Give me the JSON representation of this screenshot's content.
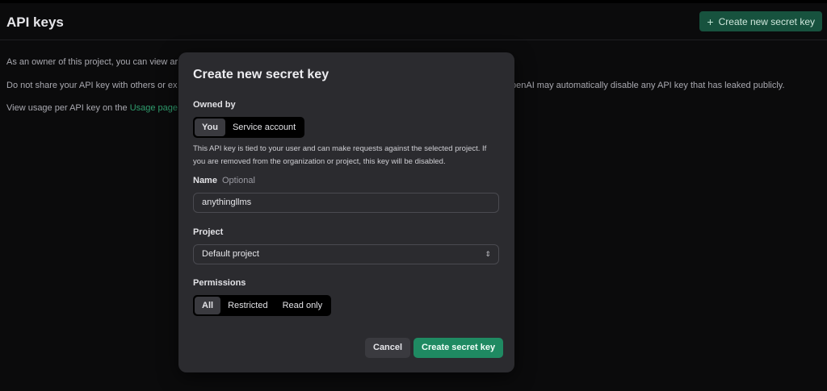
{
  "colors": {
    "background": "#0b0b0c",
    "modal": "#2b2b2f",
    "accent": "#1f8a62",
    "header_button": "#17523e",
    "link": "#2f9d6e"
  },
  "header": {
    "title": "API keys",
    "create_button": "Create new secret key",
    "create_icon": "plus-icon"
  },
  "background_text": {
    "line1": "As an owner of this project, you can view ar",
    "line2": "Do not share your API key with others or ex",
    "line2_right": "penAI may automatically disable any API key that has leaked publicly.",
    "line3_prefix": "View usage per API key on the ",
    "line3_link": "Usage page."
  },
  "modal": {
    "title": "Create new secret key",
    "owned_by": {
      "label": "Owned by",
      "options": [
        "You",
        "Service account"
      ],
      "selected": "You"
    },
    "description": "This API key is tied to your user and can make requests against the selected project. If you are removed from the organization or project, this key will be disabled.",
    "name": {
      "label": "Name",
      "optional": "Optional",
      "value": "anythingllms"
    },
    "project": {
      "label": "Project",
      "value": "Default project",
      "icon": "chevron-up-down-icon"
    },
    "permissions": {
      "label": "Permissions",
      "options": [
        "All",
        "Restricted",
        "Read only"
      ],
      "selected": "All"
    },
    "buttons": {
      "cancel": "Cancel",
      "create": "Create secret key"
    }
  }
}
